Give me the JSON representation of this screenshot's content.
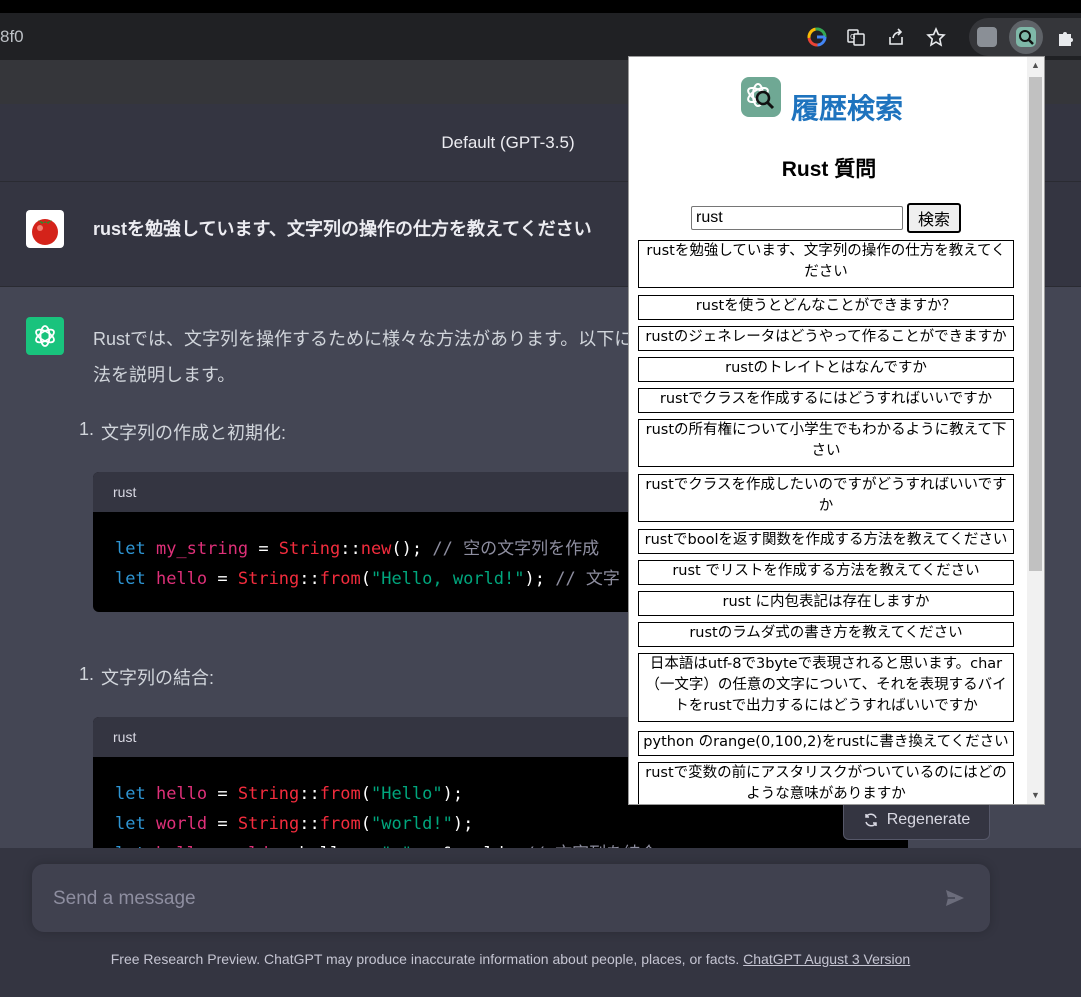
{
  "browser": {
    "url_fragment": "8f0"
  },
  "chatgpt": {
    "model_label": "Default (GPT-3.5)",
    "user_message": "rustを勉強しています、文字列の操作の仕方を教えてください",
    "answer_intro_line1": "Rustでは、文字列を操作するために様々な方法があります。以下にい",
    "answer_intro_line2": "法を説明します。",
    "list_item_1": "文字列の作成と初期化:",
    "list_item_2": "文字列の結合:",
    "list_number_1": "1.",
    "list_number_2": "1.",
    "code_block_1": {
      "lang": "rust",
      "lines": [
        [
          "let",
          "my_string",
          " = ",
          "String",
          "::",
          "new",
          "(); ",
          "// 空の文字列を作成"
        ],
        [
          "let",
          "hello",
          " = ",
          "String",
          "::",
          "from",
          "(",
          "\"Hello, world!\"",
          "); ",
          "// 文字"
        ]
      ]
    },
    "code_block_2": {
      "lang": "rust",
      "lines": [
        [
          "let",
          "hello",
          " = ",
          "String",
          "::",
          "from",
          "(",
          "\"Hello\"",
          ");"
        ],
        [
          "let",
          "world",
          " = ",
          "String",
          "::",
          "from",
          "(",
          "\"world!\"",
          ");"
        ],
        [
          "let",
          "hello_world",
          " = hello + ",
          "\" \"",
          " + &world; ",
          "// 文字列を結合"
        ]
      ]
    },
    "regenerate_label": "Regenerate",
    "input_placeholder": "Send a message",
    "footer_text": "Free Research Preview. ChatGPT may produce inaccurate information about people, places, or facts.",
    "footer_link": "ChatGPT August 3 Version"
  },
  "popup": {
    "title": "履歴検索",
    "subtitle": "Rust 質問",
    "search_value": "rust",
    "search_button": "検索",
    "results": [
      "rustを勉強しています、文字列の操作の仕方を教えてください",
      "rustを使うとどんなことができますか？",
      "rustのジェネレータはどうやって作ることができますか",
      "rustのトレイトとはなんですか",
      "rustでクラスを作成するにはどうすればいいですか",
      "rustの所有権について小学生でもわかるように教えて下さい",
      "rustでクラスを作成したいのですがどうすればいいですか",
      "rustでboolを返す関数を作成する方法を教えてください",
      "rust でリストを作成する方法を教えてください",
      "rust に内包表記は存在しますか",
      "rustのラムダ式の書き方を教えてください",
      "日本語はutf-8で3byteで表現されると思います。char（一文字）の任意の文字について、それを表現するバイトをrustで出力するにはどうすればいいですか",
      "python のrange(0,100,2)をrustに書き換えてください",
      "rustで変数の前にアスタリスクがついているのにはどのような意味がありますか"
    ]
  }
}
